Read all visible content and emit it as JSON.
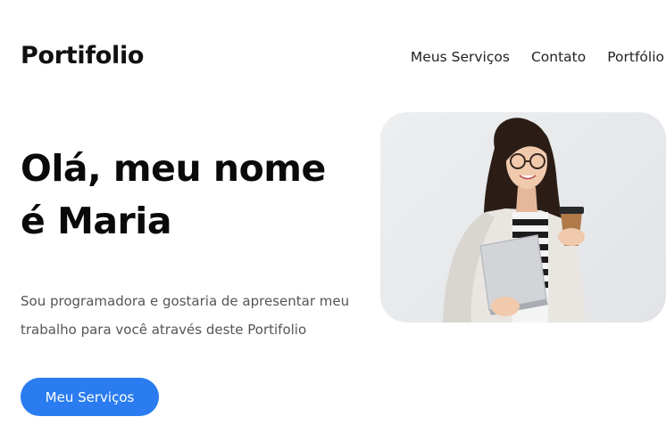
{
  "header": {
    "logo": "Portifolio",
    "nav": [
      "Meus Serviços",
      "Contato",
      "Portfólio"
    ]
  },
  "hero": {
    "title_line1": "Olá, meu nome",
    "title_line2": "é Maria",
    "description": "Sou programadora e gostaria de apresentar meu trabalho para você através deste Portifolio",
    "cta_label": "Meu Serviços"
  },
  "colors": {
    "accent": "#2a7cf0",
    "photo_bg": "#e6e8ea"
  }
}
